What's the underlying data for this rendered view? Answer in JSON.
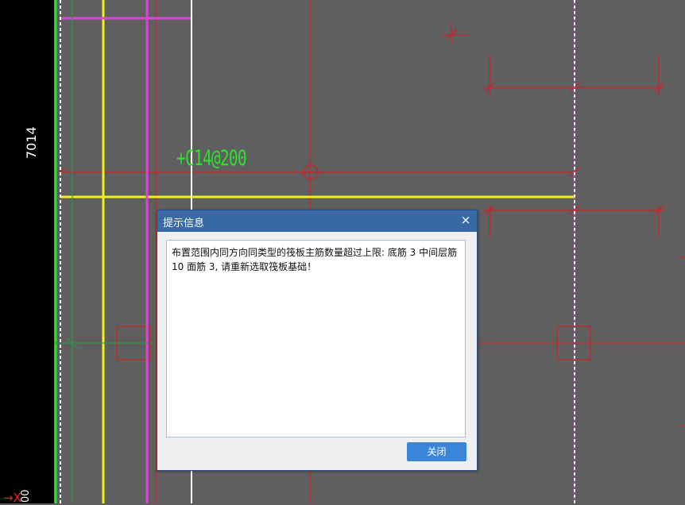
{
  "ruler": {
    "dimension_label": "7014"
  },
  "axis": {
    "x_label": "X",
    "y_tick_label": "00"
  },
  "drawing": {
    "rebar_annotation": "+C14@200",
    "colors": {
      "background": "#5f5f5f",
      "grid_red": "#e01818",
      "rebar_yellow": "#f2f21a",
      "rebar_magenta": "#e040e0",
      "annotation_green": "#2ee02e",
      "axis_green": "#1fa03a"
    }
  },
  "dialog": {
    "title": "提示信息",
    "close_icon": "×",
    "message": "布置范围内同方向同类型的筏板主筋数量超过上限: 底筋 3 中间层筋 10 面筋 3, 请重新选取筏板基础！",
    "close_button_label": "关闭"
  }
}
